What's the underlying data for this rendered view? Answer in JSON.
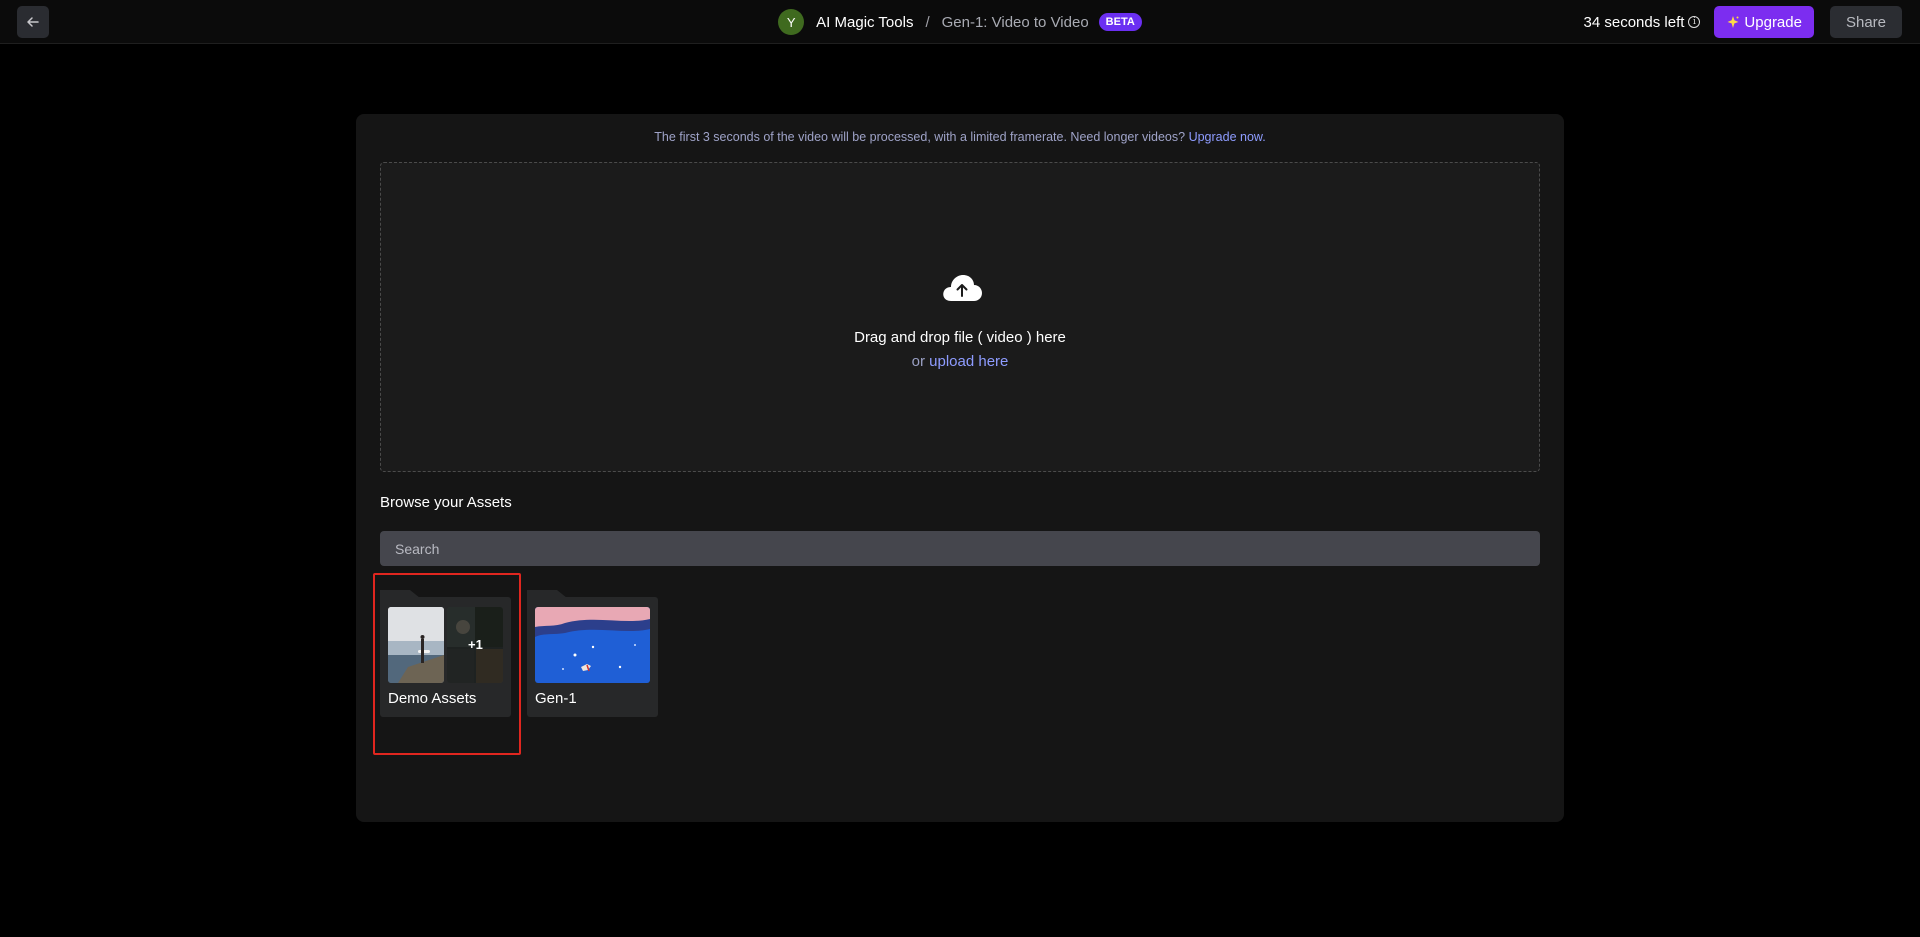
{
  "header": {
    "avatar_letter": "Y",
    "root": "AI Magic Tools",
    "separator": "/",
    "current": "Gen-1: Video to Video",
    "badge": "BETA",
    "time_left": "34 seconds left",
    "upgrade_label": "Upgrade",
    "share_label": "Share"
  },
  "notice": {
    "text": "The first 3 seconds of the video will be processed, with a limited framerate. Need longer videos?",
    "link": "Upgrade now."
  },
  "dropzone": {
    "title": "Drag and drop file ( video ) here",
    "or": "or",
    "link": "upload here"
  },
  "assets": {
    "title": "Browse your Assets",
    "search_placeholder": "Search",
    "folders": [
      {
        "name": "Demo Assets",
        "extra_count": "+1"
      },
      {
        "name": "Gen-1"
      }
    ]
  },
  "colors": {
    "accent": "#7c2df0",
    "link": "#8e9cff",
    "highlight": "#e0261f"
  }
}
